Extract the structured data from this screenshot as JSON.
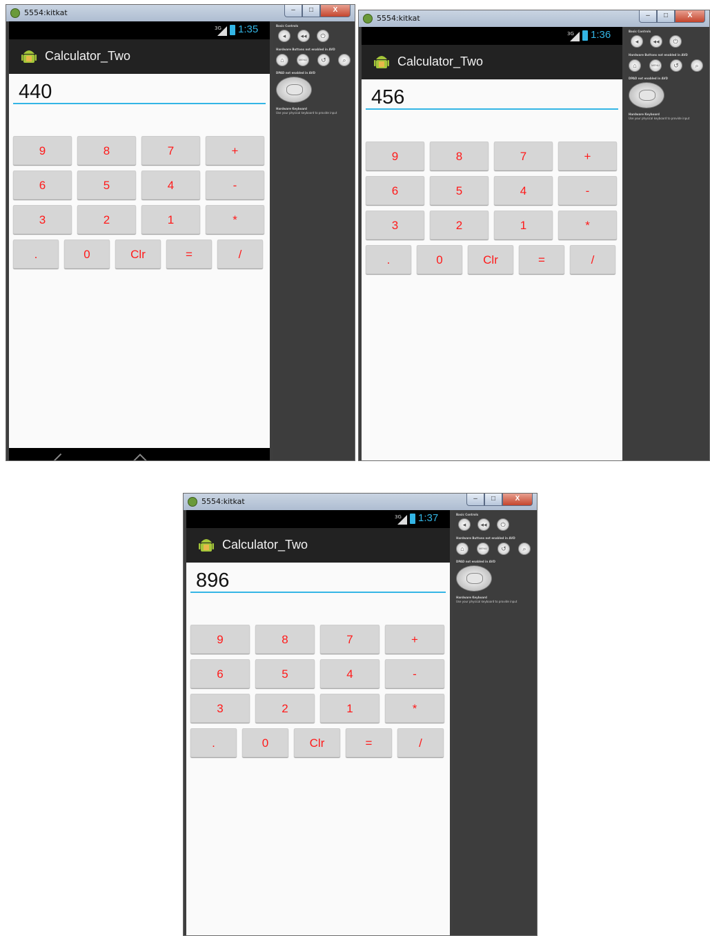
{
  "emulators": [
    {
      "window_title": "5554:kitkat",
      "window_buttons": [
        "–",
        "□",
        "X"
      ],
      "status": {
        "signal": "3G",
        "time": "1:35"
      },
      "app_title": "Calculator_Two",
      "display_value": "440",
      "keypad_rows": [
        [
          "9",
          "8",
          "7",
          "+"
        ],
        [
          "6",
          "5",
          "4",
          "-"
        ],
        [
          "3",
          "2",
          "1",
          "*"
        ],
        [
          ".",
          "0",
          "Clr",
          "=",
          "/"
        ]
      ],
      "panel": {
        "basic_controls": "Basic Controls",
        "hardware_buttons": "Hardware Buttons not enabled in AVD",
        "dpad": "DPAD not enabled in AVD",
        "hw_keyboard": "Hardware Keyboard",
        "hw_keyboard_hint": "Use your physical keyboard to provide input",
        "menu_label": "MENU"
      }
    },
    {
      "window_title": "5554:kitkat",
      "window_buttons": [
        "–",
        "□",
        "X"
      ],
      "status": {
        "signal": "3G",
        "time": "1:36"
      },
      "app_title": "Calculator_Two",
      "display_value": "456",
      "keypad_rows": [
        [
          "9",
          "8",
          "7",
          "+"
        ],
        [
          "6",
          "5",
          "4",
          "-"
        ],
        [
          "3",
          "2",
          "1",
          "*"
        ],
        [
          ".",
          "0",
          "Clr",
          "=",
          "/"
        ]
      ],
      "panel": {
        "basic_controls": "Basic Controls",
        "hardware_buttons": "Hardware Buttons not enabled in AVD",
        "dpad": "DPAD not enabled in AVD",
        "hw_keyboard": "Hardware Keyboard",
        "hw_keyboard_hint": "Use your physical keyboard to provide input",
        "menu_label": "MENU"
      }
    },
    {
      "window_title": "5554:kitkat",
      "window_buttons": [
        "–",
        "□",
        "X"
      ],
      "status": {
        "signal": "3G",
        "time": "1:37"
      },
      "app_title": "Calculator_Two",
      "display_value": "896",
      "keypad_rows": [
        [
          "9",
          "8",
          "7",
          "+"
        ],
        [
          "6",
          "5",
          "4",
          "-"
        ],
        [
          "3",
          "2",
          "1",
          "*"
        ],
        [
          ".",
          "0",
          "Clr",
          "=",
          "/"
        ]
      ],
      "panel": {
        "basic_controls": "Basic Controls",
        "hardware_buttons": "Hardware Buttons not enabled in AVD",
        "dpad": "DPAD not enabled in AVD",
        "hw_keyboard": "Hardware Keyboard",
        "hw_keyboard_hint": "Use your physical keyboard to provide input",
        "menu_label": "MENU"
      }
    }
  ],
  "colors": {
    "accent": "#33b5e5",
    "key_text": "#ff1a1a",
    "key_bg": "#d6d6d6",
    "action_bar": "#222222"
  }
}
